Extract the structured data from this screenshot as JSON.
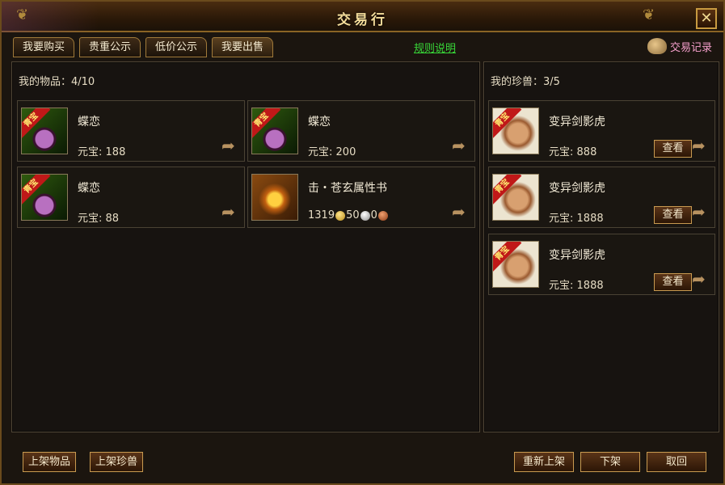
{
  "window": {
    "title": "交易行",
    "close_glyph": "✕"
  },
  "tabs": [
    {
      "label": "我要购买"
    },
    {
      "label": "贵重公示"
    },
    {
      "label": "低价公示"
    },
    {
      "label": "我要出售"
    }
  ],
  "rules_link": "规则说明",
  "history_label": "交易记录",
  "left_panel": {
    "header": "我的物品：4/10",
    "items": [
      {
        "name": "蝶恋",
        "price_label": "元宝:",
        "price": "188",
        "icon": "gem-icon",
        "badge": "青宝"
      },
      {
        "name": "蝶恋",
        "price_label": "元宝:",
        "price": "200",
        "icon": "gem-icon",
        "badge": "青宝"
      },
      {
        "name": "蝶恋",
        "price_label": "元宝:",
        "price": "88",
        "icon": "gem-icon",
        "badge": "青宝"
      },
      {
        "name": "击・苍玄属性书",
        "icon": "book-icon",
        "gold": "1319",
        "silver": "50",
        "copper": "0"
      }
    ]
  },
  "right_panel": {
    "header": "我的珍兽：3/5",
    "pets": [
      {
        "name": "变异剑影虎",
        "price_label": "元宝:",
        "price": "888",
        "view_label": "查看",
        "badge": "青宝"
      },
      {
        "name": "变异剑影虎",
        "price_label": "元宝:",
        "price": "1888",
        "view_label": "查看",
        "badge": "青宝"
      },
      {
        "name": "变异剑影虎",
        "price_label": "元宝:",
        "price": "1888",
        "view_label": "查看",
        "badge": "青宝"
      }
    ]
  },
  "bottom": {
    "list_item": "上架物品",
    "list_pet": "上架珍兽",
    "relist": "重新上架",
    "delist": "下架",
    "cancel": "取回"
  },
  "colors": {
    "rules_link": "#38d838",
    "history": "#f6a0cc",
    "badge": "#c01818"
  }
}
